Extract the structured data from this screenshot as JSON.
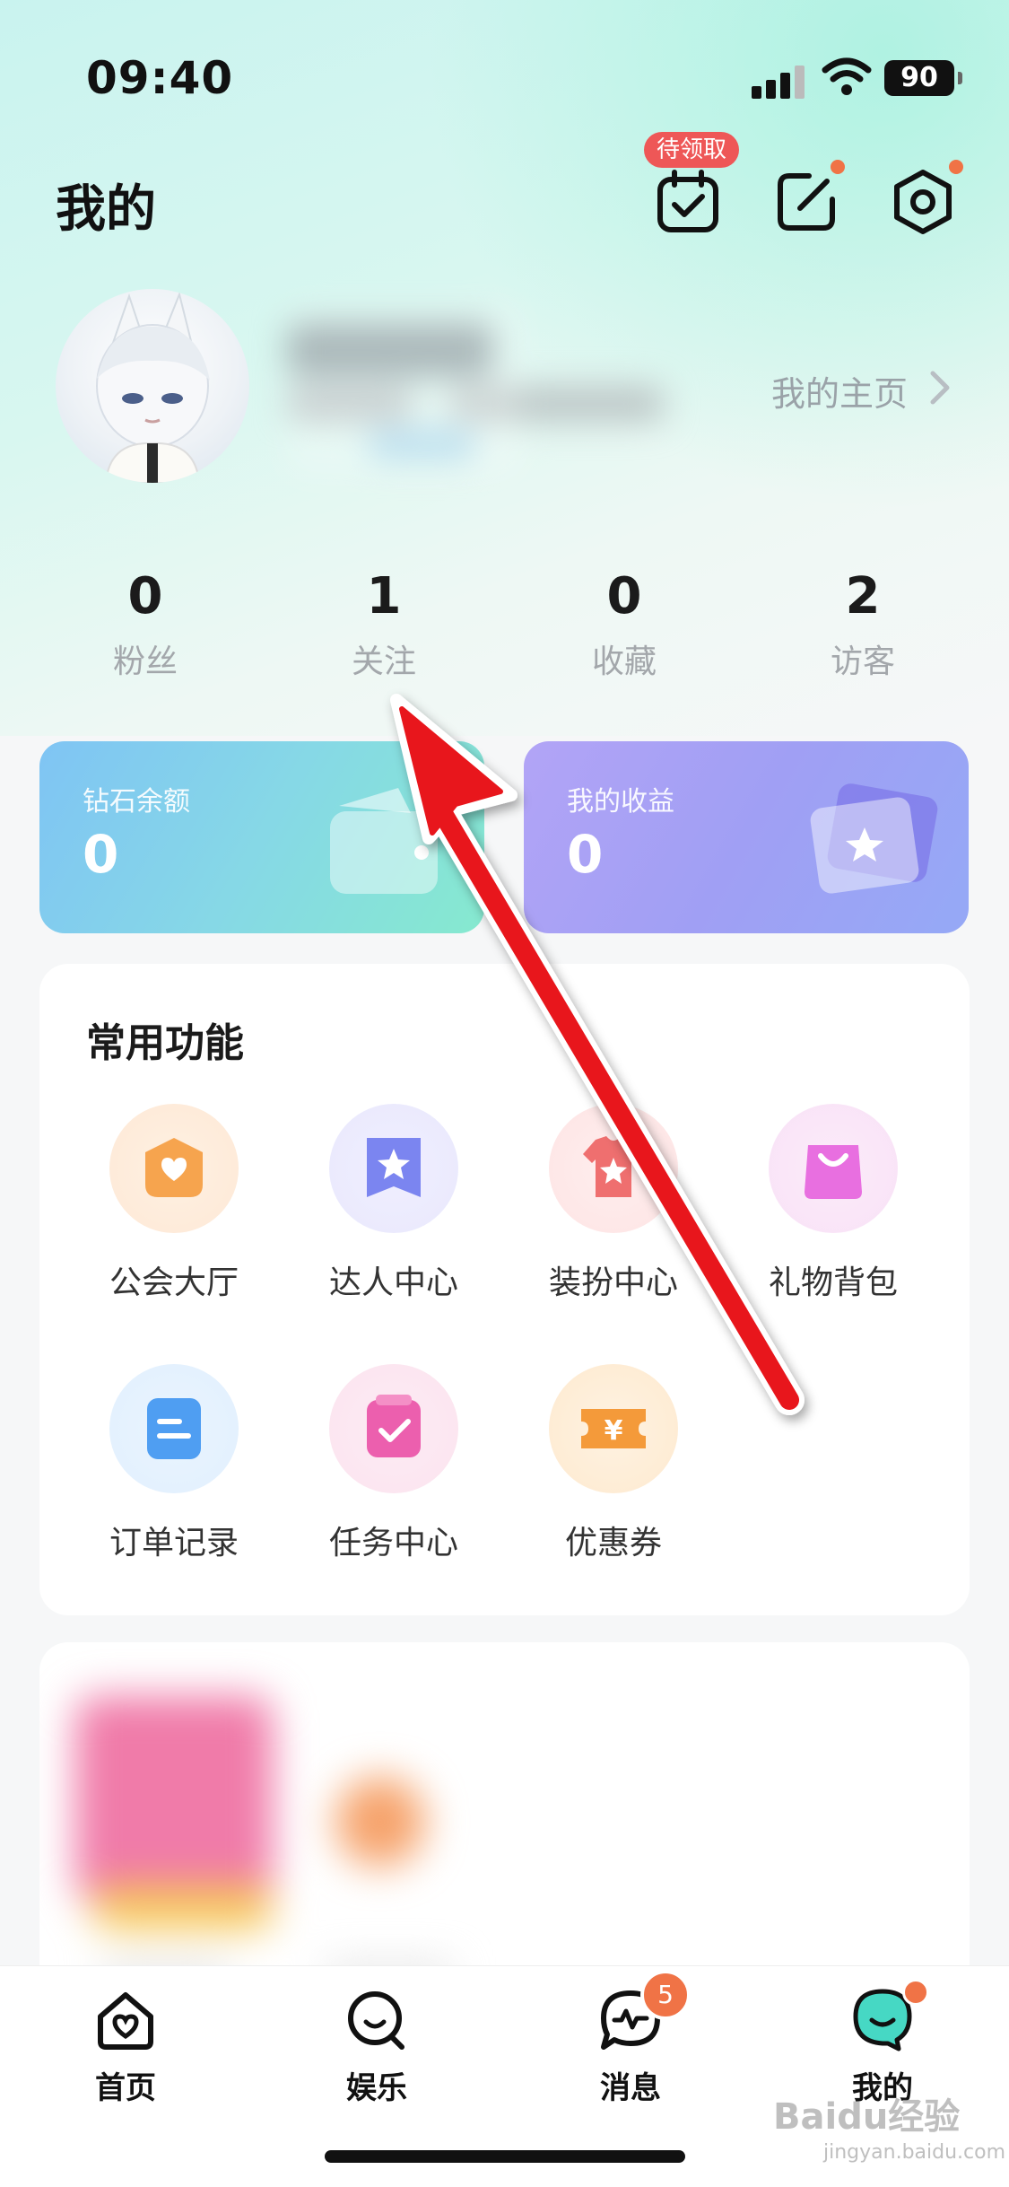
{
  "status_bar": {
    "time": "09:40",
    "battery": "90"
  },
  "header": {
    "title": "我的",
    "checkin_badge": "待领取"
  },
  "profile": {
    "homepage_link": "我的主页"
  },
  "stats": [
    {
      "value": "0",
      "label": "粉丝"
    },
    {
      "value": "1",
      "label": "关注"
    },
    {
      "value": "0",
      "label": "收藏"
    },
    {
      "value": "2",
      "label": "访客"
    }
  ],
  "cards": {
    "diamond": {
      "title": "钻石余额",
      "value": "0"
    },
    "earnings": {
      "title": "我的收益",
      "value": "0"
    }
  },
  "functions": {
    "title": "常用功能",
    "items": [
      {
        "label": "公会大厅",
        "icon": "guild-hall-icon"
      },
      {
        "label": "达人中心",
        "icon": "star-bookmark-icon"
      },
      {
        "label": "装扮中心",
        "icon": "outfit-icon"
      },
      {
        "label": "礼物背包",
        "icon": "gift-bag-icon"
      },
      {
        "label": "订单记录",
        "icon": "order-record-icon"
      },
      {
        "label": "任务中心",
        "icon": "task-check-icon"
      },
      {
        "label": "优惠券",
        "icon": "coupon-icon"
      }
    ]
  },
  "tabbar": {
    "tabs": [
      {
        "label": "首页"
      },
      {
        "label": "娱乐"
      },
      {
        "label": "消息",
        "badge": "5"
      },
      {
        "label": "我的"
      }
    ]
  },
  "watermark": {
    "text": "Baidu经验",
    "sub": "jingyan.baidu.com"
  },
  "colors": {
    "arrow": "#e8141b",
    "accent_orange": "#f07346",
    "badge_red": "#ee5757"
  }
}
